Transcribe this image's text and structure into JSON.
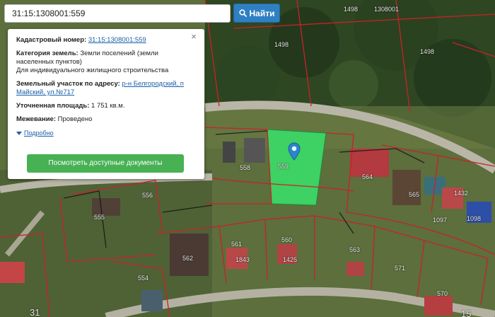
{
  "search": {
    "value": "31:15:1308001:559",
    "button_label": "Найти",
    "button_icon": "search-icon"
  },
  "info": {
    "close_label": "×",
    "cadastral_number_label": "Кадастровый номер:",
    "cadastral_number_value": "31:15:1308001:559",
    "land_category_label": "Категория земель:",
    "land_category_value": "Земли поселений (земли населенных пунктов)",
    "land_use_value": "Для индивидуального жилищного строительства",
    "address_label": "Земельный участок по адресу:",
    "address_value": "р-н Белгородский, п Майский, ул.№717",
    "area_label": "Уточненная площадь:",
    "area_value": "1 751 кв.м.",
    "survey_label": "Межевание:",
    "survey_value": "Проведено",
    "details_link": "Подробно",
    "docs_button": "Посмотреть доступные документы"
  },
  "map": {
    "selected_color": "#3ed163",
    "boundary_color": "#c8222a",
    "labels": {
      "l1498a": "1498",
      "l1308001": "1308001",
      "l1498b": "1498",
      "l1498c": "1498",
      "l555": "555",
      "l556": "556",
      "l558": "558",
      "l559": "559",
      "l564": "564",
      "l565": "565",
      "l1098": "1098",
      "l560": "560",
      "l561": "561",
      "l562": "562",
      "l563": "563",
      "l571": "571",
      "l554": "554",
      "l570": "570",
      "l1843": "1843",
      "l1425": "1425",
      "l1432": "1432",
      "l1097": "1097",
      "l31": "31",
      "l15": "15"
    }
  }
}
